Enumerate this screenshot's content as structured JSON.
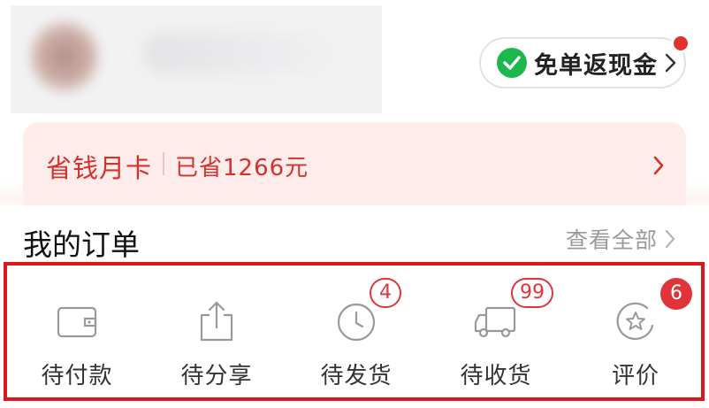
{
  "header": {
    "cashback": {
      "label": "免单返现金",
      "icon": "wechat-check-icon"
    }
  },
  "savings_card": {
    "title": "省钱月卡",
    "amount": "已省1266元"
  },
  "orders": {
    "title": "我的订单",
    "view_all": "查看全部",
    "items": [
      {
        "label": "待付款",
        "icon": "wallet-icon",
        "badge": ""
      },
      {
        "label": "待分享",
        "icon": "share-icon",
        "badge": ""
      },
      {
        "label": "待发货",
        "icon": "clock-icon",
        "badge": "4"
      },
      {
        "label": "待收货",
        "icon": "truck-icon",
        "badge": "99"
      },
      {
        "label": "评价",
        "icon": "review-star-icon",
        "badge": "6"
      }
    ]
  },
  "colors": {
    "accent_red": "#e0343a",
    "highlight_border": "#e0161c",
    "savings_bg": "#fdeceb",
    "wechat_green": "#1cb84d"
  }
}
